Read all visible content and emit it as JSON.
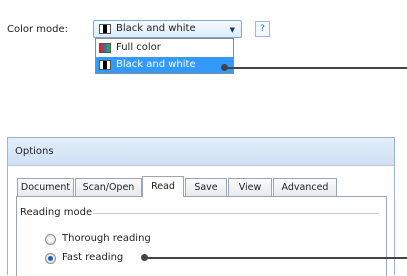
{
  "color_mode": {
    "label": "Color mode:",
    "selected": "Black and white",
    "help": "?",
    "options": [
      {
        "label": "Full color",
        "icon": "full-color-swatch-icon"
      },
      {
        "label": "Black and white",
        "icon": "black-white-swatch-icon",
        "highlighted": true
      }
    ]
  },
  "options_dialog": {
    "title": "Options",
    "tabs": [
      "Document",
      "Scan/Open",
      "Read",
      "Save",
      "View",
      "Advanced"
    ],
    "active_tab": "Read",
    "reading_mode": {
      "label": "Reading mode",
      "options": [
        {
          "label": "Thorough reading",
          "checked": false
        },
        {
          "label": "Fast reading",
          "checked": true
        }
      ]
    }
  }
}
